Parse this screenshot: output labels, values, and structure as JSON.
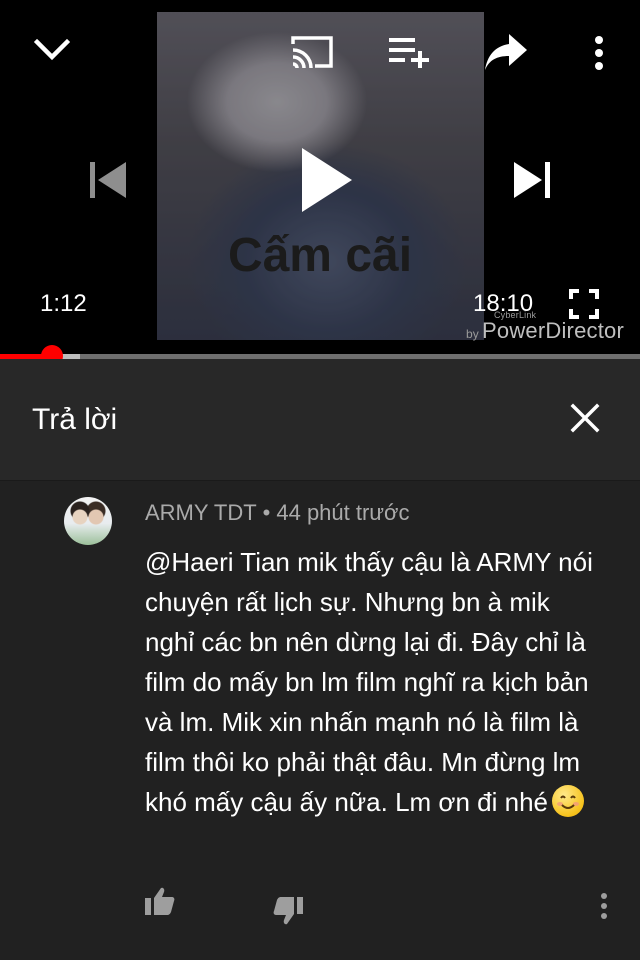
{
  "player": {
    "caption_text": "Cấm cãi",
    "current_time": "1:12",
    "duration": "18:10",
    "progress_fraction": 0.082,
    "buffered_fraction": 0.125,
    "watermark": {
      "by": "by",
      "cyberlink": "CyberLink",
      "brand": "PowerDirector"
    },
    "icons": {
      "collapse": "chevron-down-icon",
      "cast": "cast-icon",
      "add_to_queue": "playlist-add-icon",
      "share": "share-icon",
      "more": "more-vertical-icon",
      "previous": "skip-previous-icon",
      "play": "play-icon",
      "next": "skip-next-icon",
      "fullscreen": "fullscreen-icon"
    },
    "colors": {
      "progress": "#ff0000",
      "background": "#000000"
    }
  },
  "reply_panel": {
    "title": "Trả lời",
    "close_icon": "close-icon"
  },
  "comment": {
    "author": "ARMY TDT",
    "separator": "•",
    "timestamp": "44 phút trước",
    "text": "@Haeri Tian mik thấy cậu là ARMY nói chuyện rất lịch sự. Nhưng bn à mik nghỉ các bn nên dừng lại đi. Đây chỉ là film do mấy bn lm film nghĩ ra kịch bản và lm. Mik xin nhấn mạnh nó là film là film thôi ko phải thật đâu. Mn đừng lm khó mấy cậu ấy nữa. Lm ơn đi nhé",
    "emoji": "smiling-face-icon",
    "actions": {
      "like": "thumbs-up-icon",
      "dislike": "thumbs-down-icon",
      "more": "more-vertical-icon"
    }
  }
}
